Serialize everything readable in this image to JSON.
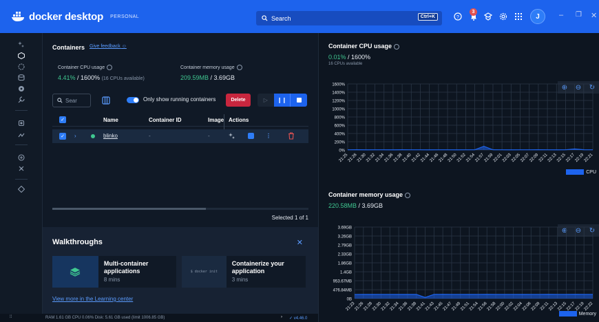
{
  "titlebar": {
    "brand": "docker desktop",
    "plan": "PERSONAL",
    "search_label": "Search",
    "shortcut": "Ctrl+K",
    "notification_count": "3",
    "avatar_initial": "J",
    "icons": [
      "help-icon",
      "bell-icon",
      "extensions-icon",
      "gear-icon",
      "grid-icon"
    ],
    "colors": {
      "titlebar": "#1d63ed",
      "accent": "#3fc790",
      "danger": "#c8263e"
    }
  },
  "containers": {
    "title": "Containers",
    "feedback_link": "Give feedback",
    "cpu_label": "Container CPU usage",
    "cpu_value": "4.41%",
    "cpu_total": " / 1600%",
    "cpu_note": "(16 CPUs available)",
    "mem_label": "Container memory usage",
    "mem_value": "209.59MB",
    "mem_total": " / 3.69GB",
    "search_placeholder": "Sear",
    "only_running_label": "Only show running containers",
    "delete_label": "Delete",
    "columns": [
      "Name",
      "Container ID",
      "Image",
      "Actions"
    ],
    "rows": [
      {
        "name": "blinko",
        "container_id": "-",
        "image": "-",
        "status": "running"
      }
    ],
    "selection_text": "Selected 1 of 1",
    "scroll_fraction": 0.6
  },
  "walkthroughs": {
    "title": "Walkthroughs",
    "cards": [
      {
        "title": "Multi-container applications",
        "duration": "8 mins"
      },
      {
        "title": "Containerize your application",
        "duration": "3 mins",
        "snippet": "$ docker init"
      }
    ],
    "link": "View more in the Learning center"
  },
  "footer": {
    "stats": "RAM 1.61 GB  CPU 0.06%   Disk: 5.61 GB used (limit 1006.85 GB)",
    "version": "v4.46.0"
  },
  "cpu_panel": {
    "title": "Container CPU usage",
    "value": "0.01%",
    "total": " / 1600%",
    "note": "16 CPUs available"
  },
  "mem_panel": {
    "title": "Container memory usage",
    "value": "220.58MB",
    "total": " / 3.69GB"
  },
  "chart_data": [
    {
      "type": "area",
      "title": "Container CPU usage",
      "ylabel": "",
      "xlabel": "",
      "y_ticks": [
        "1600%",
        "1400%",
        "1200%",
        "1000%",
        "800%",
        "600%",
        "400%",
        "200%",
        "0%"
      ],
      "ylim": [
        0,
        1600
      ],
      "x_ticks": [
        "21:25",
        "21:26",
        "21:30",
        "21:32",
        "21:34",
        "21:36",
        "21:38",
        "21:40",
        "21:42",
        "21:44",
        "21:46",
        "21:48",
        "21:50",
        "21:52",
        "21:54",
        "21:57",
        "21:59",
        "22:01",
        "22:03",
        "22:05",
        "22:07",
        "22:09",
        "22:11",
        "22:13",
        "22:15",
        "22:17",
        "22:19",
        "22:21"
      ],
      "series": [
        {
          "name": "CPU",
          "color": "#1d63ed",
          "values": [
            5,
            6,
            4,
            5,
            5,
            4,
            6,
            5,
            5,
            4,
            5,
            5,
            4,
            5,
            5,
            90,
            6,
            5,
            4,
            5,
            5,
            6,
            5,
            4,
            5,
            25,
            6,
            5
          ]
        }
      ],
      "grid": true,
      "legend": "bottom-right"
    },
    {
      "type": "area",
      "title": "Container memory usage",
      "ylabel": "",
      "xlabel": "",
      "y_ticks": [
        "3.69GB",
        "3.26GB",
        "2.79GB",
        "2.33GB",
        "1.86GB",
        "1.4GB",
        "953.67MB",
        "476.84MB",
        "0B"
      ],
      "ylim": [
        0,
        3690
      ],
      "x_ticks": [
        "21:23",
        "21:26",
        "21:28",
        "21:30",
        "21:32",
        "21:34",
        "21:36",
        "21:38",
        "21:41",
        "21:43",
        "21:45",
        "21:47",
        "21:49",
        "21:51",
        "21:54",
        "21:56",
        "21:58",
        "22:00",
        "22:02",
        "22:04",
        "22:06",
        "22:09",
        "22:11",
        "22:13",
        "22:15",
        "22:17",
        "22:19",
        "22:22"
      ],
      "series": [
        {
          "name": "Memory",
          "color": "#1d63ed",
          "values": [
            215,
            218,
            216,
            220,
            219,
            217,
            216,
            218,
            60,
            220,
            221,
            219,
            220,
            218,
            219,
            221,
            220,
            219,
            220,
            218,
            219,
            220,
            221,
            219,
            220,
            221,
            220,
            220
          ]
        }
      ],
      "grid": true,
      "legend": "bottom-right"
    }
  ]
}
